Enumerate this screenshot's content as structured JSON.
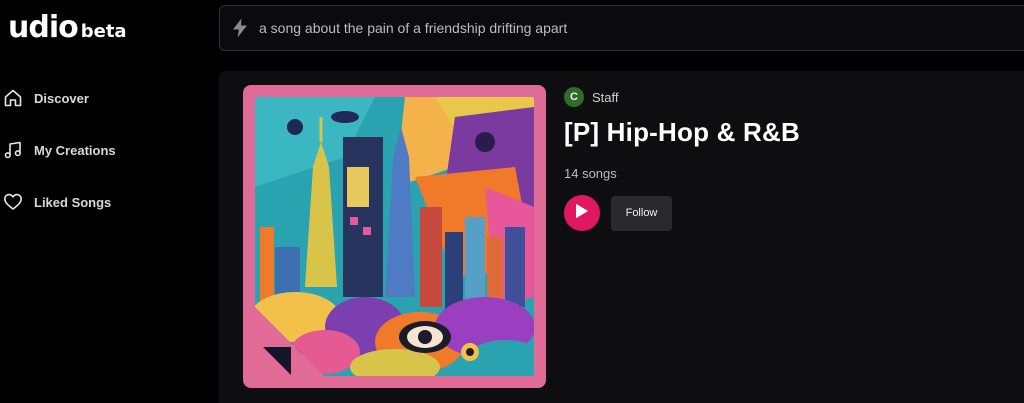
{
  "brand": {
    "name": "udio",
    "tag": "beta"
  },
  "sidebar": {
    "items": [
      {
        "label": "Discover",
        "icon": "home-icon"
      },
      {
        "label": "My Creations",
        "icon": "music-note-icon"
      },
      {
        "label": "Liked Songs",
        "icon": "heart-icon"
      }
    ]
  },
  "search": {
    "placeholder": "a song about the pain of a friendship drifting apart",
    "icon": "lightning-icon"
  },
  "playlist": {
    "owner_initial": "C",
    "owner_name": "Staff",
    "title": "[P] Hip-Hop & R&B",
    "song_count": "14 songs",
    "follow_label": "Follow"
  },
  "colors": {
    "accent": "#e0185f",
    "cover_frame": "#e16b97",
    "avatar": "#2f6b2a"
  }
}
